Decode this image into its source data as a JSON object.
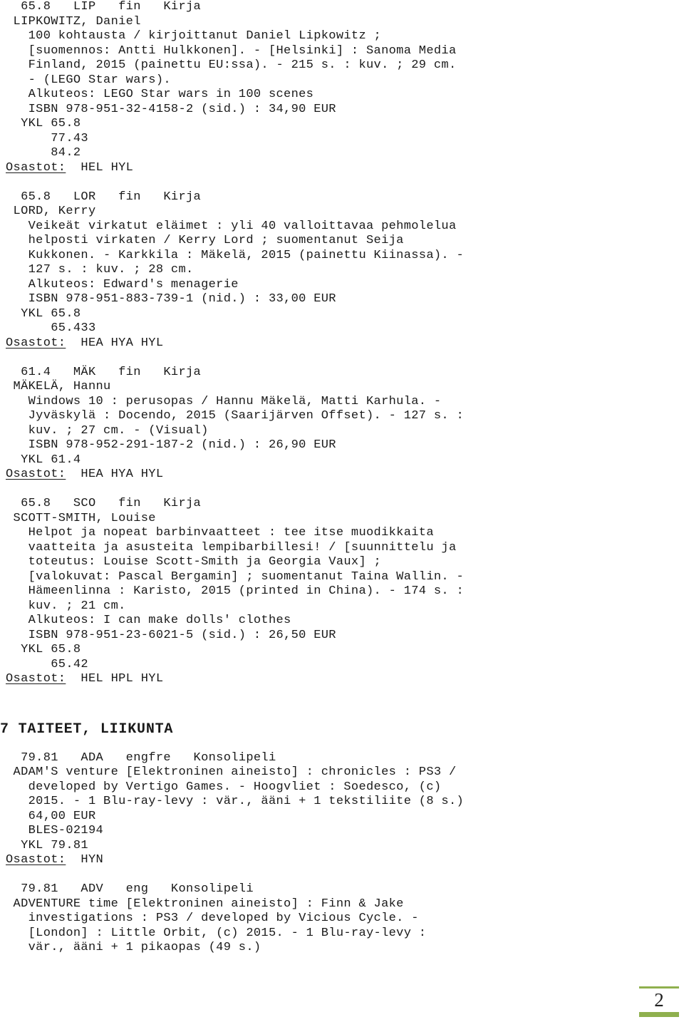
{
  "document": {
    "type": "library-accessions-list",
    "language": "fi"
  },
  "records": [
    {
      "id": "lipkowitz",
      "lines": [
        "  65.8   LIP   fin   Kirja",
        " LIPKOWITZ, Daniel",
        "   100 kohtausta / kirjoittanut Daniel Lipkowitz ;",
        "   [suomennos: Antti Hulkkonen]. - [Helsinki] : Sanoma Media",
        "   Finland, 2015 (painettu EU:ssa). - 215 s. : kuv. ; 29 cm.",
        "   - (LEGO Star wars).",
        "   Alkuteos: LEGO Star wars in 100 scenes",
        "   ISBN 978-951-32-4158-2 (sid.) : 34,90 EUR",
        "  YKL 65.8",
        "      77.43",
        "      84.2"
      ],
      "dept_label": "Osastot:",
      "dept_values": "  HEL HYL"
    },
    {
      "id": "lord",
      "lines": [
        "  65.8   LOR   fin   Kirja",
        " LORD, Kerry",
        "   Veikeät virkatut eläimet : yli 40 valloittavaa pehmolelua",
        "   helposti virkaten / Kerry Lord ; suomentanut Seija",
        "   Kukkonen. - Karkkila : Mäkelä, 2015 (painettu Kiinassa). -",
        "   127 s. : kuv. ; 28 cm.",
        "   Alkuteos: Edward's menagerie",
        "   ISBN 978-951-883-739-1 (nid.) : 33,00 EUR",
        "  YKL 65.8",
        "      65.433"
      ],
      "dept_label": "Osastot:",
      "dept_values": "  HEA HYA HYL"
    },
    {
      "id": "makela",
      "lines": [
        "  61.4   MÄK   fin   Kirja",
        " MÄKELÄ, Hannu",
        "   Windows 10 : perusopas / Hannu Mäkelä, Matti Karhula. -",
        "   Jyväskylä : Docendo, 2015 (Saarijärven Offset). - 127 s. :",
        "   kuv. ; 27 cm. - (Visual)",
        "   ISBN 978-952-291-187-2 (nid.) : 26,90 EUR",
        "  YKL 61.4"
      ],
      "dept_label": "Osastot:",
      "dept_values": "  HEA HYA HYL"
    },
    {
      "id": "scott-smith",
      "lines": [
        "  65.8   SCO   fin   Kirja",
        " SCOTT-SMITH, Louise",
        "   Helpot ja nopeat barbinvaatteet : tee itse muodikkaita",
        "   vaatteita ja asusteita lempibarbillesi! / [suunnittelu ja",
        "   toteutus: Louise Scott-Smith ja Georgia Vaux] ;",
        "   [valokuvat: Pascal Bergamin] ; suomentanut Taina Wallin. -",
        "   Hämeenlinna : Karisto, 2015 (printed in China). - 174 s. :",
        "   kuv. ; 21 cm.",
        "   Alkuteos: I can make dolls' clothes",
        "   ISBN 978-951-23-6021-5 (sid.) : 26,50 EUR",
        "  YKL 65.8",
        "      65.42"
      ],
      "dept_label": "Osastot:",
      "dept_values": "  HEL HPL HYL"
    }
  ],
  "section": {
    "heading": "7 TAITEET, LIIKUNTA"
  },
  "records_after_heading": [
    {
      "id": "adams-venture",
      "lines": [
        "  79.81   ADA   engfre   Konsolipeli",
        " ADAM'S venture [Elektroninen aineisto] : chronicles : PS3 /",
        "   developed by Vertigo Games. - Hoogvliet : Soedesco, (c)",
        "   2015. - 1 Blu-ray-levy : vär., ääni + 1 tekstiliite (8 s.)",
        "   64,00 EUR",
        "   BLES-02194",
        "  YKL 79.81"
      ],
      "dept_label": "Osastot:",
      "dept_values": "  HYN"
    },
    {
      "id": "adventure-time",
      "lines": [
        "  79.81   ADV   eng   Konsolipeli",
        " ADVENTURE time [Elektroninen aineisto] : Finn & Jake",
        "   investigations : PS3 / developed by Vicious Cycle. -",
        "   [London] : Little Orbit, (c) 2015. - 1 Blu-ray-levy :",
        "   vär., ääni + 1 pikaopas (49 s.)"
      ],
      "dept_label": "",
      "dept_values": ""
    }
  ],
  "footer": {
    "page_number": "2",
    "rule_color": "#8FB04E"
  }
}
